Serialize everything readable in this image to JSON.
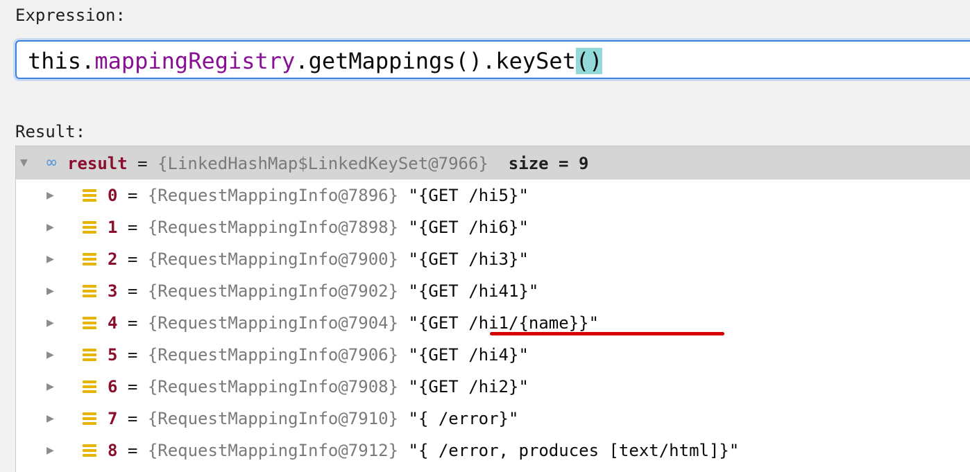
{
  "expression": {
    "label": "Expression:",
    "text_prefix": "this.",
    "text_field": "mappingRegistry",
    "text_mid": ".getMappings().keySet",
    "text_open": "(",
    "text_close": ")"
  },
  "result": {
    "label": "Result:",
    "root": {
      "name": "result",
      "eq": " = ",
      "type": "{LinkedHashMap$LinkedKeySet@7966}",
      "size_label": "size = 9"
    },
    "items": [
      {
        "index": "0",
        "type": "{RequestMappingInfo@7896}",
        "value": "\"{GET /hi5}\""
      },
      {
        "index": "1",
        "type": "{RequestMappingInfo@7898}",
        "value": "\"{GET /hi6}\""
      },
      {
        "index": "2",
        "type": "{RequestMappingInfo@7900}",
        "value": "\"{GET /hi3}\""
      },
      {
        "index": "3",
        "type": "{RequestMappingInfo@7902}",
        "value": "\"{GET /hi41}\""
      },
      {
        "index": "4",
        "type": "{RequestMappingInfo@7904}",
        "value": "\"{GET /hi1/{name}}\""
      },
      {
        "index": "5",
        "type": "{RequestMappingInfo@7906}",
        "value": "\"{GET /hi4}\""
      },
      {
        "index": "6",
        "type": "{RequestMappingInfo@7908}",
        "value": "\"{GET /hi2}\""
      },
      {
        "index": "7",
        "type": "{RequestMappingInfo@7910}",
        "value": "\"{ /error}\""
      },
      {
        "index": "8",
        "type": "{RequestMappingInfo@7912}",
        "value": "\"{ /error, produces [text/html]}\""
      }
    ]
  },
  "colors": {
    "accent_border": "#3d7fdc",
    "annotation_underline": "#d40000",
    "index_color": "#8a0f2e",
    "list_icon": "#e6b400"
  },
  "icons": {
    "root_expand": "triangle-down-icon",
    "root_watch": "infinity-icon",
    "row_expand": "triangle-right-icon",
    "row_type": "list-icon"
  }
}
